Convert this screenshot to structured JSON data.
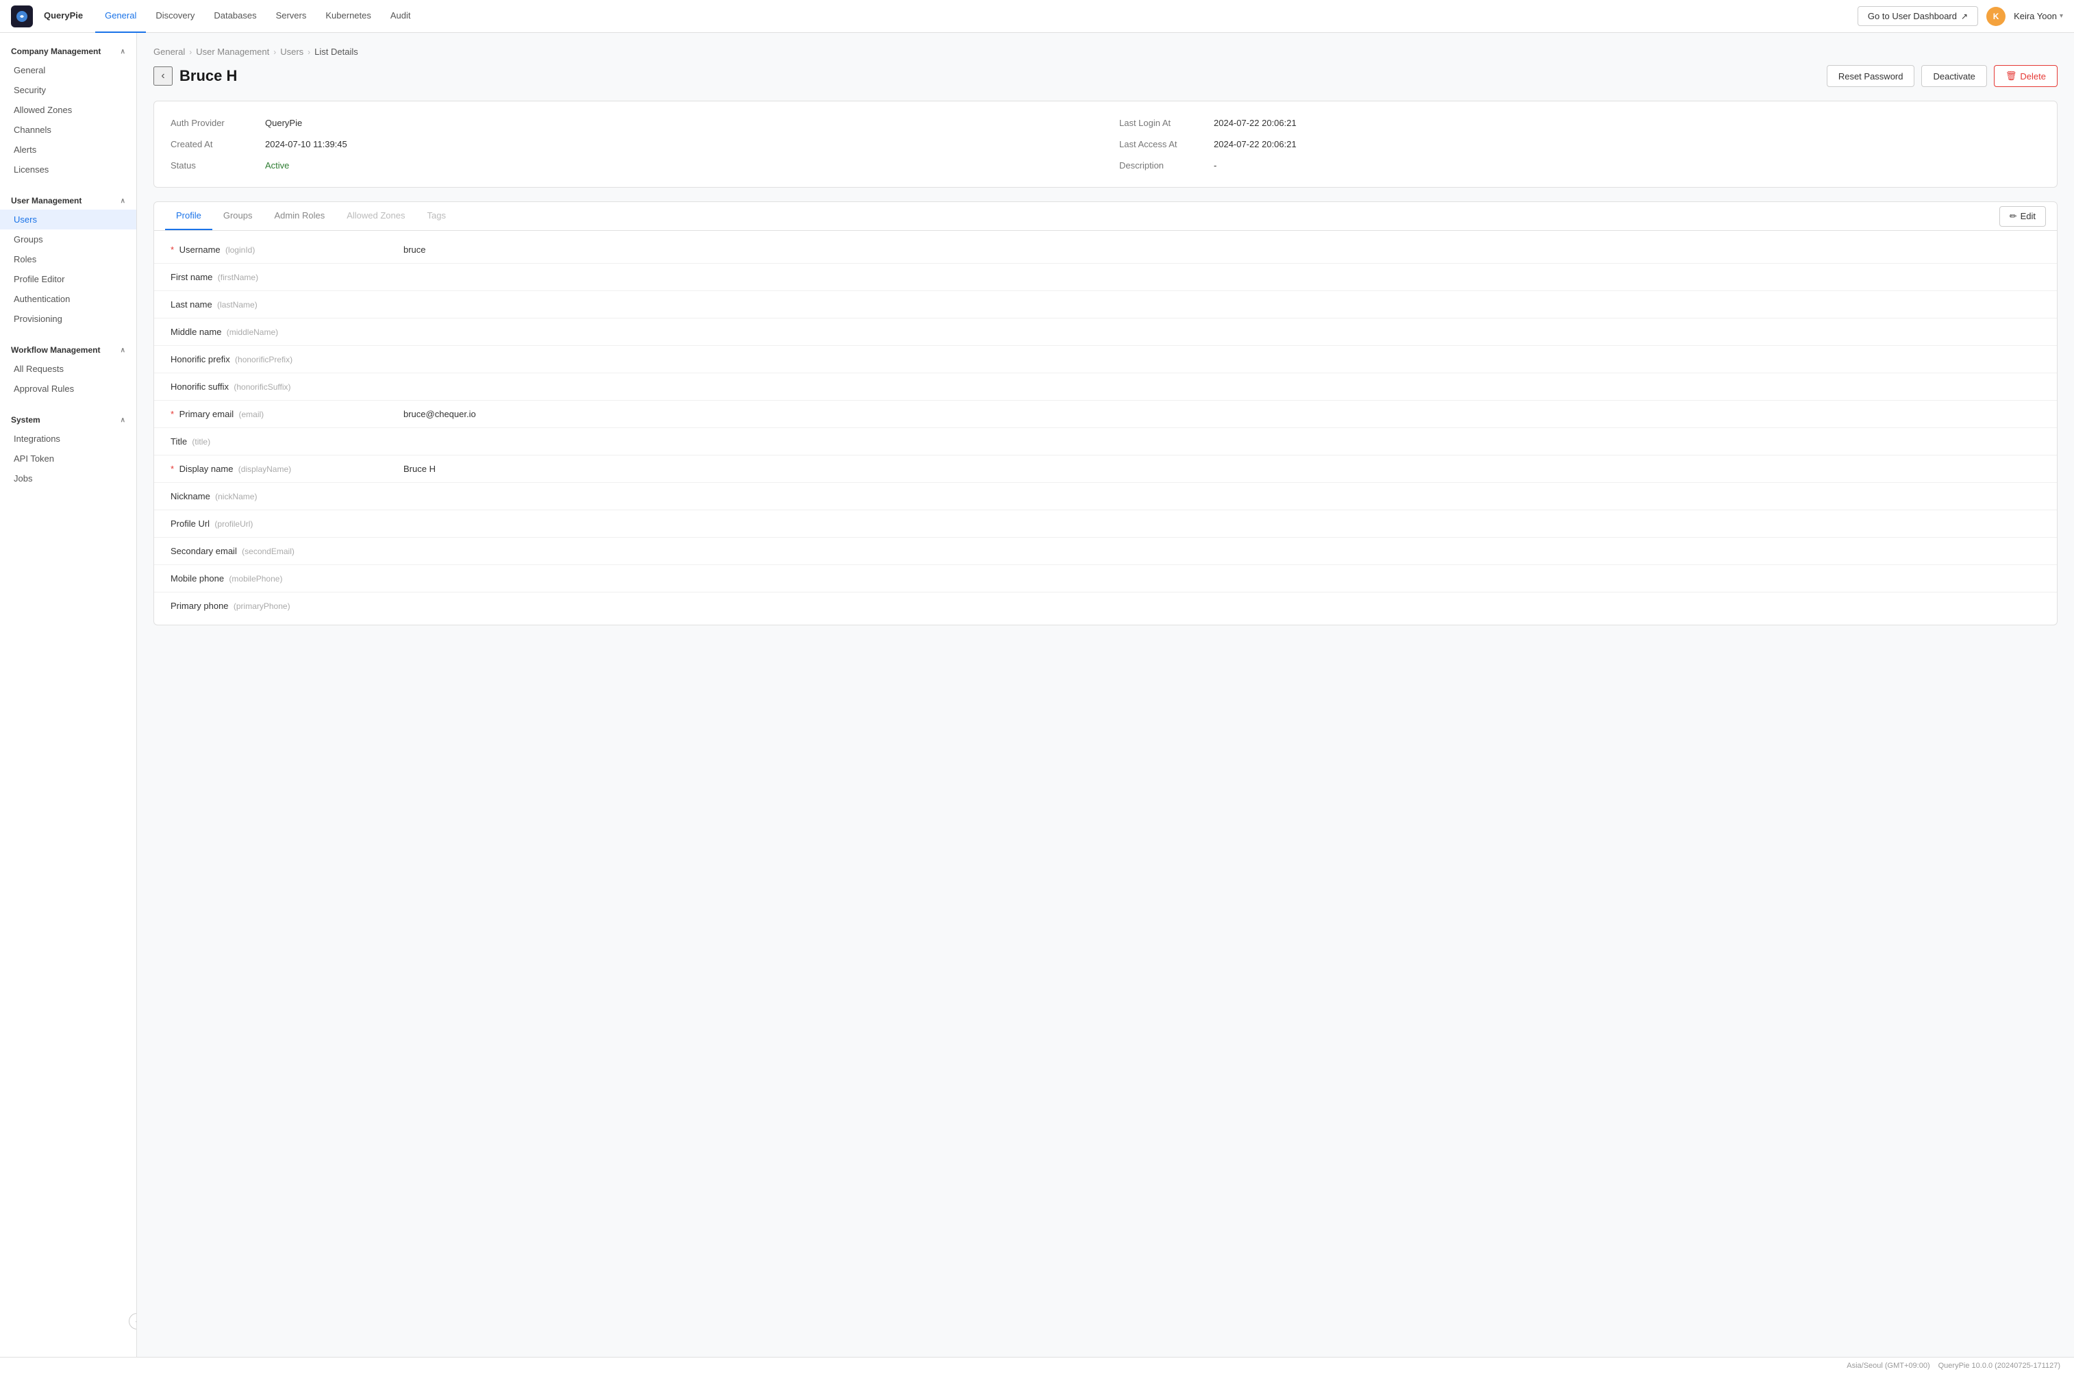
{
  "app": {
    "logo_alt": "QueryPie Logo"
  },
  "top_nav": {
    "brand": "QueryPie",
    "items": [
      {
        "label": "General",
        "active": true
      },
      {
        "label": "Discovery",
        "active": false
      },
      {
        "label": "Databases",
        "active": false
      },
      {
        "label": "Servers",
        "active": false
      },
      {
        "label": "Kubernetes",
        "active": false
      },
      {
        "label": "Audit",
        "active": false
      }
    ],
    "dashboard_btn": "Go to User Dashboard",
    "user_name": "Keira Yoon",
    "user_initials": "K"
  },
  "sidebar": {
    "sections": [
      {
        "label": "Company Management",
        "collapsed": false,
        "items": [
          {
            "label": "General",
            "active": false
          },
          {
            "label": "Security",
            "active": false
          },
          {
            "label": "Allowed Zones",
            "active": false
          },
          {
            "label": "Channels",
            "active": false
          },
          {
            "label": "Alerts",
            "active": false
          },
          {
            "label": "Licenses",
            "active": false
          }
        ]
      },
      {
        "label": "User Management",
        "collapsed": false,
        "items": [
          {
            "label": "Users",
            "active": true
          },
          {
            "label": "Groups",
            "active": false
          },
          {
            "label": "Roles",
            "active": false
          },
          {
            "label": "Profile Editor",
            "active": false
          },
          {
            "label": "Authentication",
            "active": false
          },
          {
            "label": "Provisioning",
            "active": false
          }
        ]
      },
      {
        "label": "Workflow Management",
        "collapsed": false,
        "items": [
          {
            "label": "All Requests",
            "active": false
          },
          {
            "label": "Approval Rules",
            "active": false
          }
        ]
      },
      {
        "label": "System",
        "collapsed": false,
        "items": [
          {
            "label": "Integrations",
            "active": false
          },
          {
            "label": "API Token",
            "active": false
          },
          {
            "label": "Jobs",
            "active": false
          }
        ]
      }
    ]
  },
  "breadcrumb": {
    "items": [
      "General",
      "User Management",
      "Users",
      "List Details"
    ]
  },
  "page_header": {
    "title": "Bruce H",
    "back_label": "‹",
    "actions": {
      "reset_password": "Reset Password",
      "deactivate": "Deactivate",
      "delete": "Delete"
    }
  },
  "info_card": {
    "fields": [
      {
        "label": "Auth Provider",
        "value": "QueryPie"
      },
      {
        "label": "Last Login At",
        "value": "2024-07-22 20:06:21"
      },
      {
        "label": "Created At",
        "value": "2024-07-10 11:39:45"
      },
      {
        "label": "Last Access At",
        "value": "2024-07-22 20:06:21"
      },
      {
        "label": "Status",
        "value": "Active",
        "status": true
      },
      {
        "label": "Description",
        "value": "-"
      }
    ]
  },
  "tabs": {
    "items": [
      {
        "label": "Profile",
        "active": true,
        "disabled": false
      },
      {
        "label": "Groups",
        "active": false,
        "disabled": false
      },
      {
        "label": "Admin Roles",
        "active": false,
        "disabled": false
      },
      {
        "label": "Allowed Zones",
        "active": false,
        "disabled": true
      },
      {
        "label": "Tags",
        "active": false,
        "disabled": true
      }
    ],
    "edit_btn": "Edit"
  },
  "profile_fields": [
    {
      "required": true,
      "name": "Username",
      "key": "(loginId)",
      "value": "bruce"
    },
    {
      "required": false,
      "name": "First name",
      "key": "(firstName)",
      "value": ""
    },
    {
      "required": false,
      "name": "Last name",
      "key": "(lastName)",
      "value": ""
    },
    {
      "required": false,
      "name": "Middle name",
      "key": "(middleName)",
      "value": ""
    },
    {
      "required": false,
      "name": "Honorific prefix",
      "key": "(honorificPrefix)",
      "value": ""
    },
    {
      "required": false,
      "name": "Honorific suffix",
      "key": "(honorificSuffix)",
      "value": ""
    },
    {
      "required": true,
      "name": "Primary email",
      "key": "(email)",
      "value": "bruce@chequer.io"
    },
    {
      "required": false,
      "name": "Title",
      "key": "(title)",
      "value": ""
    },
    {
      "required": true,
      "name": "Display name",
      "key": "(displayName)",
      "value": "Bruce H"
    },
    {
      "required": false,
      "name": "Nickname",
      "key": "(nickName)",
      "value": ""
    },
    {
      "required": false,
      "name": "Profile Url",
      "key": "(profileUrl)",
      "value": ""
    },
    {
      "required": false,
      "name": "Secondary email",
      "key": "(secondEmail)",
      "value": ""
    },
    {
      "required": false,
      "name": "Mobile phone",
      "key": "(mobilePhone)",
      "value": ""
    },
    {
      "required": false,
      "name": "Primary phone",
      "key": "(primaryPhone)",
      "value": ""
    }
  ],
  "footer": {
    "timezone": "Asia/Seoul (GMT+09:00)",
    "version": "QueryPie 10.0.0 (20240725-171127)"
  }
}
